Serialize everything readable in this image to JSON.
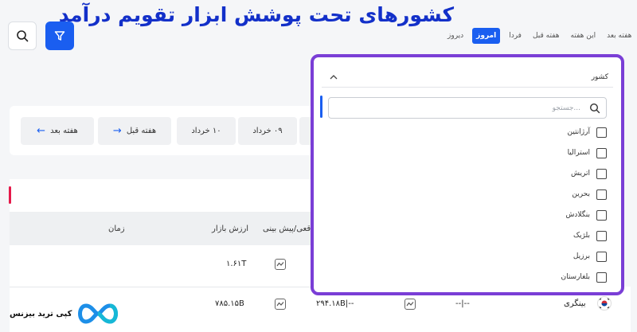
{
  "headline": "کشورهای تحت پوشش ابزار تقویم درآمد",
  "toolbar": {
    "day_tabs": [
      "دیروز",
      "امروز",
      "فردا",
      "هفته قبل",
      "این هفته",
      "هفته بعد"
    ],
    "active_tab": "امروز"
  },
  "week_nav": {
    "next_week": "هفته بعد",
    "prev_week": "هفته قبل",
    "day_10": "۱۰ خرداد",
    "day_9": "۰۹ خرداد"
  },
  "table": {
    "headers": {
      "time": "زمان",
      "market_cap": "ارزش بازار",
      "actual_forecast": "واقعی/پیش بینی"
    },
    "rows": [
      {
        "market_cap": "۱.۶۱T",
        "actual": "",
        "forecast": ""
      },
      {
        "market_cap": "۷۸۵.۱۵B",
        "actual_forecast": "۲۹۴.۱۸B|--",
        "eps": "--|--",
        "company": "بینگری"
      }
    ]
  },
  "brand": {
    "name": "کپی ترید بیزنس"
  },
  "country_filter": {
    "title": "کشور",
    "search_placeholder": "...جستجو",
    "countries": [
      "آرژانتین",
      "استرالیا",
      "اتریش",
      "بحرین",
      "بنگلادش",
      "بلژیک",
      "برزیل",
      "بلغارستان"
    ]
  },
  "colors": {
    "accent": "#1a5ef0",
    "highlight_border": "#7a3ed6",
    "headline": "#1330c9",
    "marker": "#e5194a"
  }
}
